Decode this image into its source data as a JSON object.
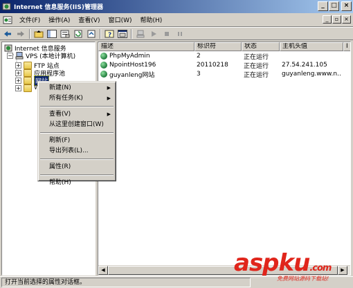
{
  "window": {
    "title": "Internet 信息服务(IIS)管理器",
    "buttons": {
      "minimize": "_",
      "maximize": "□",
      "close": "×"
    }
  },
  "menubar": {
    "items": [
      "文件(F)",
      "操作(A)",
      "查看(V)",
      "窗口(W)",
      "帮助(H)"
    ],
    "mdi": {
      "minimize": "_",
      "restore": "▫",
      "close": "×"
    }
  },
  "toolbar": {
    "icons": [
      "back-icon",
      "forward-icon",
      "up-icon",
      "show-tree-icon",
      "properties-icon",
      "refresh-icon",
      "export-icon",
      "help-icon",
      "new-window-icon",
      "computer-icon",
      "start-icon",
      "stop-icon",
      "pause-icon"
    ]
  },
  "tree": {
    "root": "Internet 信息服务",
    "computer": "VPS (本地计算机)",
    "children": [
      "FTP 站点",
      "应用程序池",
      "网站",
      "W"
    ]
  },
  "list": {
    "columns": [
      "描述",
      "标识符",
      "状态",
      "主机头值",
      "I"
    ],
    "rows": [
      {
        "desc": "PhpMyAdmin",
        "id": "2",
        "status": "正在运行",
        "host": ""
      },
      {
        "desc": "NpointHost196",
        "id": "20110218",
        "status": "正在运行",
        "host": "27.54.241.105"
      },
      {
        "desc": "guyanleng网站",
        "id": "3",
        "status": "正在运行",
        "host": "guyanleng.www.n.."
      }
    ]
  },
  "context_menu": {
    "groups": [
      [
        {
          "label": "新建(N)",
          "submenu": true
        },
        {
          "label": "所有任务(K)",
          "submenu": true
        }
      ],
      [
        {
          "label": "查看(V)",
          "submenu": true
        },
        {
          "label": "从这里创建窗口(W)",
          "submenu": false
        }
      ],
      [
        {
          "label": "刷新(F)",
          "submenu": false
        },
        {
          "label": "导出列表(L)...",
          "submenu": false
        }
      ],
      [
        {
          "label": "属性(R)",
          "submenu": false
        }
      ],
      [
        {
          "label": "帮助(H)",
          "submenu": false
        }
      ]
    ]
  },
  "statusbar": {
    "text": "打开当前选择的属性对话框。"
  },
  "watermark": {
    "logo_a": "asp",
    "logo_b": "ku",
    "logo_c": ".com",
    "sub": "免费网站源码下载站!"
  },
  "colors": {
    "title_start": "#0a246a",
    "title_end": "#a6caf0",
    "selection": "#0a246a",
    "watermark": "#e0251b"
  }
}
